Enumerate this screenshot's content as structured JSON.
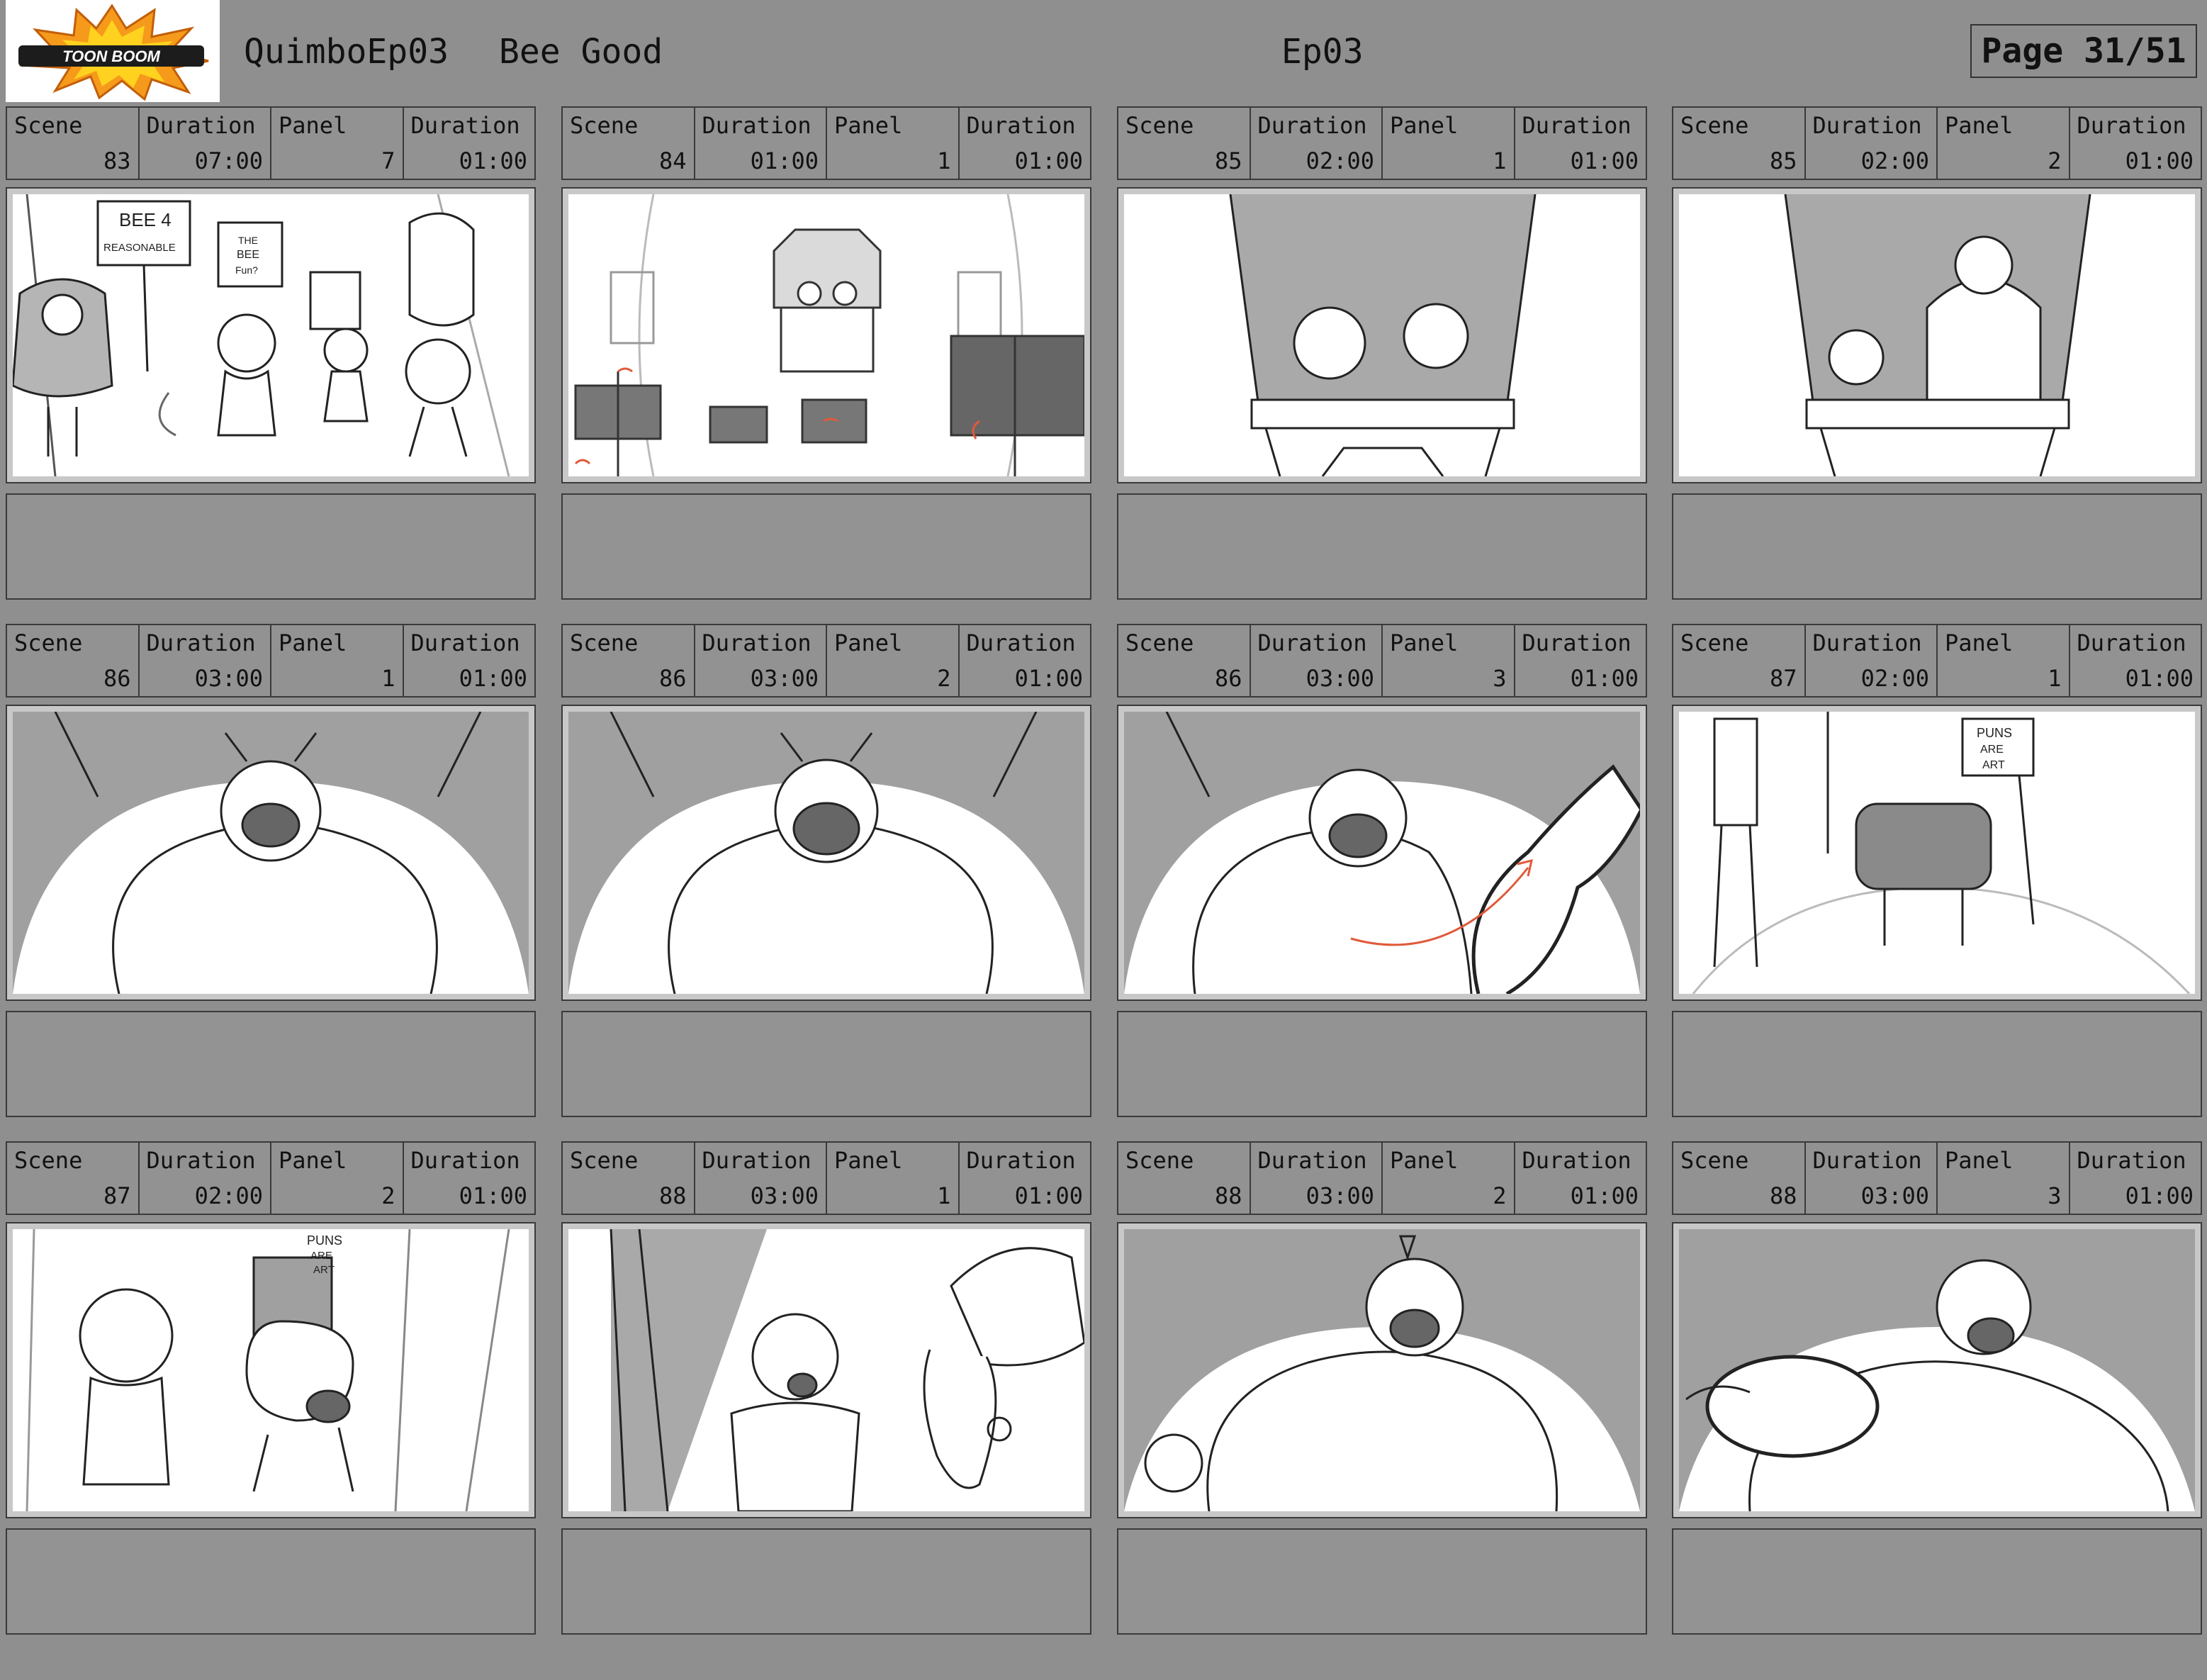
{
  "header": {
    "logo_text": "TOON BOOM",
    "project": "QuimboEp03",
    "episode_title": "Bee Good",
    "episode": "Ep03",
    "page": "Page 31/51"
  },
  "labels": {
    "scene": "Scene",
    "duration": "Duration",
    "panel": "Panel"
  },
  "panels": [
    {
      "scene": "83",
      "scene_duration": "07:00",
      "panel": "7",
      "panel_duration": "01:00",
      "notes": ""
    },
    {
      "scene": "84",
      "scene_duration": "01:00",
      "panel": "1",
      "panel_duration": "01:00",
      "notes": ""
    },
    {
      "scene": "85",
      "scene_duration": "02:00",
      "panel": "1",
      "panel_duration": "01:00",
      "notes": ""
    },
    {
      "scene": "85",
      "scene_duration": "02:00",
      "panel": "2",
      "panel_duration": "01:00",
      "notes": ""
    },
    {
      "scene": "86",
      "scene_duration": "03:00",
      "panel": "1",
      "panel_duration": "01:00",
      "notes": ""
    },
    {
      "scene": "86",
      "scene_duration": "03:00",
      "panel": "2",
      "panel_duration": "01:00",
      "notes": ""
    },
    {
      "scene": "86",
      "scene_duration": "03:00",
      "panel": "3",
      "panel_duration": "01:00",
      "notes": ""
    },
    {
      "scene": "87",
      "scene_duration": "02:00",
      "panel": "1",
      "panel_duration": "01:00",
      "notes": ""
    },
    {
      "scene": "87",
      "scene_duration": "02:00",
      "panel": "2",
      "panel_duration": "01:00",
      "notes": ""
    },
    {
      "scene": "88",
      "scene_duration": "03:00",
      "panel": "1",
      "panel_duration": "01:00",
      "notes": ""
    },
    {
      "scene": "88",
      "scene_duration": "03:00",
      "panel": "2",
      "panel_duration": "01:00",
      "notes": ""
    },
    {
      "scene": "88",
      "scene_duration": "03:00",
      "panel": "3",
      "panel_duration": "01:00",
      "notes": ""
    }
  ],
  "sketch_text": {
    "sign_bee_reasonable_1": "BEE 4",
    "sign_bee_reasonable_2": "REASONABLE",
    "sign_bee_fun_1": "THE",
    "sign_bee_fun_2": "BEE",
    "sign_bee_fun_3": "Fun?",
    "sign_puns_art_1": "PUNS",
    "sign_puns_art_2": "ARE",
    "sign_puns_art_3": "ART"
  },
  "colors": {
    "background": "#8f8f8f",
    "logo_orange": "#f59a1b",
    "logo_yellow": "#ffd21f",
    "action_red": "#e05a3a"
  }
}
